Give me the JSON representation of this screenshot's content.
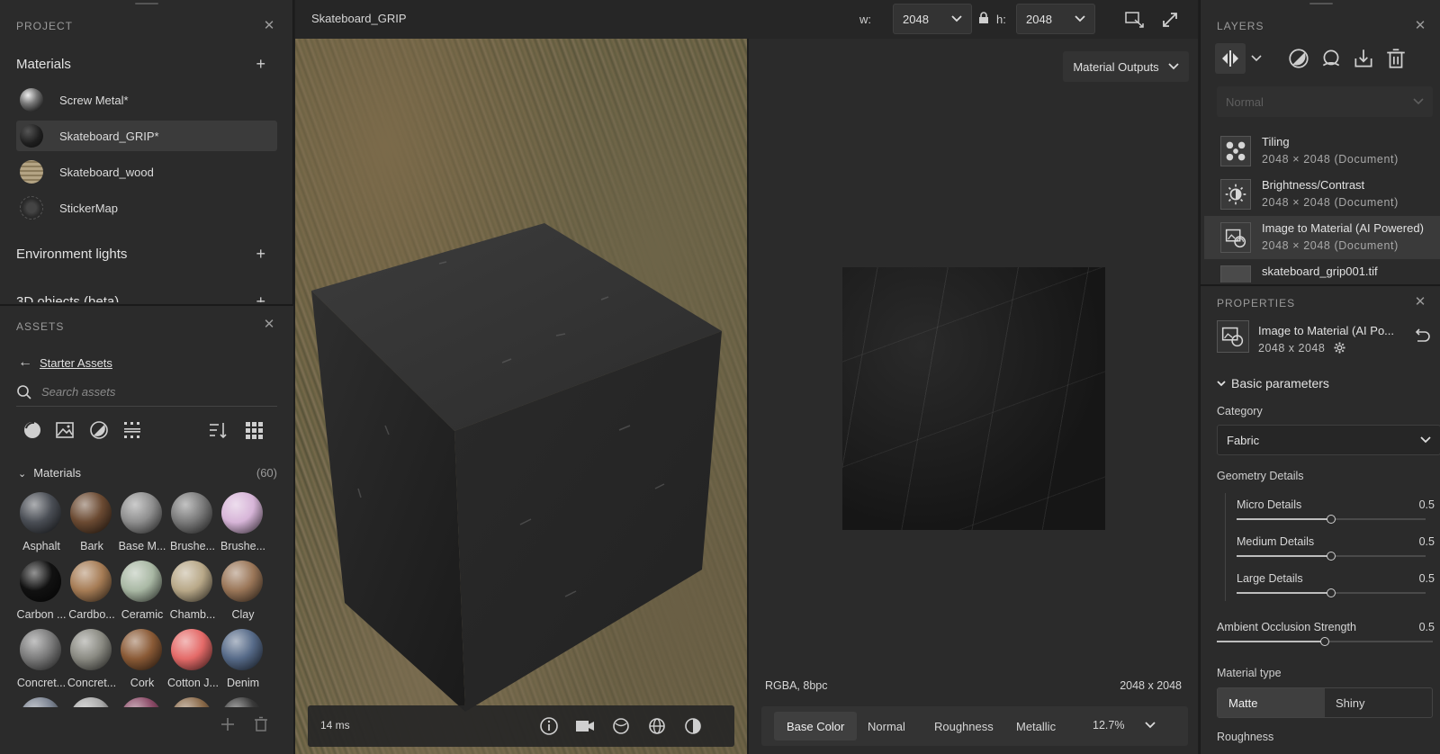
{
  "project": {
    "title": "PROJECT",
    "materials_heading": "Materials",
    "materials": [
      {
        "name": "Screw Metal*",
        "selected": false,
        "swatch": "#8a8a8a"
      },
      {
        "name": "Skateboard_GRIP*",
        "selected": true,
        "swatch": "#2a2a2a"
      },
      {
        "name": "Skateboard_wood",
        "selected": false,
        "swatch": "#a89878"
      },
      {
        "name": "StickerMap",
        "selected": false,
        "swatch": "#3a3a3a"
      }
    ],
    "env_heading": "Environment lights",
    "objects_heading": "3D objects (beta)"
  },
  "assets": {
    "title": "ASSETS",
    "back_label": "Starter Assets",
    "search_placeholder": "Search assets",
    "materials_label": "Materials",
    "materials_count": "(60)",
    "items": [
      {
        "name": "Asphalt",
        "color": "#4a4e55"
      },
      {
        "name": "Bark",
        "color": "#6b4a32"
      },
      {
        "name": "Base M...",
        "color": "#8e8e8e"
      },
      {
        "name": "Brushe...",
        "color": "#7a7a7a"
      },
      {
        "name": "Brushe...",
        "color": "#d7b5d8"
      },
      {
        "name": "Carbon ...",
        "color": "#111111"
      },
      {
        "name": "Cardbo...",
        "color": "#a67c55"
      },
      {
        "name": "Ceramic",
        "color": "#a9b8a4"
      },
      {
        "name": "Chamb...",
        "color": "#b8a888"
      },
      {
        "name": "Clay",
        "color": "#9a7658"
      },
      {
        "name": "Concret...",
        "color": "#7a7a7a"
      },
      {
        "name": "Concret...",
        "color": "#8a8a82"
      },
      {
        "name": "Cork",
        "color": "#8a5a36"
      },
      {
        "name": "Cotton J...",
        "color": "#e46a68"
      },
      {
        "name": "Denim",
        "color": "#566a88"
      },
      {
        "name": "",
        "color": "#7a8290"
      },
      {
        "name": "",
        "color": "#aaaaaa"
      },
      {
        "name": "",
        "color": "#8a4a66"
      },
      {
        "name": "",
        "color": "#8a6a4a"
      },
      {
        "name": "",
        "color": "#3a3a3a"
      }
    ]
  },
  "topbar": {
    "doc_name": "Skateboard_GRIP",
    "w_label": "w:",
    "w_value": "2048",
    "h_label": "h:",
    "h_value": "2048"
  },
  "viewport3d": {
    "render_time": "14 ms"
  },
  "viewport2d": {
    "material_outputs_label": "Material Outputs",
    "format": "RGBA, 8bpc",
    "resolution": "2048 x 2048",
    "channels": [
      "Base Color",
      "Normal",
      "Roughness",
      "Metallic"
    ],
    "active_channel": "Base Color",
    "zoom": "12.7%"
  },
  "layers": {
    "title": "LAYERS",
    "blend_mode": "Normal",
    "items": [
      {
        "name": "Tiling",
        "sub": "2048 × 2048 (Document)",
        "icon": "tiling-icon",
        "selected": false
      },
      {
        "name": "Brightness/Contrast",
        "sub": "2048 × 2048 (Document)",
        "icon": "brightness-icon",
        "selected": false
      },
      {
        "name": "Image to Material (AI Powered)",
        "sub": "2048 × 2048 (Document)",
        "icon": "image-to-material-icon",
        "selected": true
      },
      {
        "name": "skateboard_grip001.tif",
        "sub": "",
        "icon": "image-thumb",
        "selected": false
      }
    ]
  },
  "properties": {
    "title": "PROPERTIES",
    "name": "Image to Material (AI Po...",
    "size": "2048 x 2048",
    "basic_params_label": "Basic parameters",
    "category_label": "Category",
    "category_value": "Fabric",
    "geometry_label": "Geometry Details",
    "sliders": [
      {
        "label": "Micro Details",
        "value": "0.5",
        "fraction": 0.5
      },
      {
        "label": "Medium Details",
        "value": "0.5",
        "fraction": 0.5
      },
      {
        "label": "Large Details",
        "value": "0.5",
        "fraction": 0.5
      }
    ],
    "ao": {
      "label": "Ambient Occlusion Strength",
      "value": "0.5",
      "fraction": 0.5
    },
    "material_type_label": "Material type",
    "material_type_options": [
      "Matte",
      "Shiny"
    ],
    "material_type_selected": "Matte",
    "roughness_label": "Roughness"
  }
}
